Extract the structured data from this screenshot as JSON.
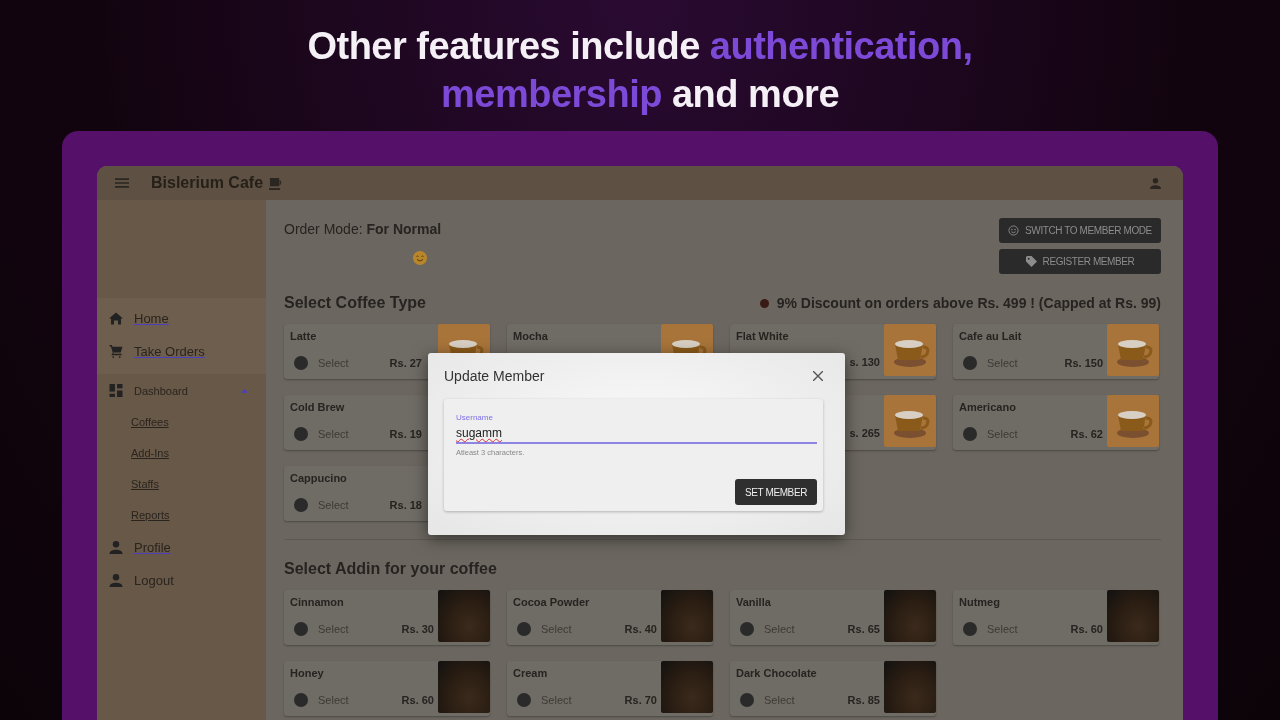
{
  "headline": {
    "lines": [
      [
        {
          "text": "Other features include ",
          "highlight": false
        },
        {
          "text": "authentication,",
          "highlight": true
        }
      ],
      [
        {
          "text": "membership",
          "highlight": true
        },
        {
          "text": " and more",
          "highlight": false
        }
      ]
    ]
  },
  "app": {
    "title": "Bislerium Cafe"
  },
  "sidebar": {
    "items": [
      {
        "label": "Home",
        "kind": "link"
      },
      {
        "label": "Take Orders",
        "kind": "link"
      },
      {
        "label": "Dashboard",
        "kind": "group",
        "expanded": true,
        "children": [
          {
            "label": "Coffees"
          },
          {
            "label": "Add-Ins"
          },
          {
            "label": "Staffs"
          },
          {
            "label": "Reports"
          }
        ]
      },
      {
        "label": "Profile",
        "kind": "link"
      },
      {
        "label": "Logout",
        "kind": "plain"
      }
    ]
  },
  "order_mode": "Order Mode: **For Normal**",
  "buttons": [
    "SWITCH TO MEMBER MODE",
    "REGISTER MEMBER"
  ],
  "coffee_section": {
    "title": "Select Coffee Type",
    "discount": "9% Discount on orders above Rs. 499 ! (Capped at Rs. 99)",
    "rows": [
      [
        {
          "name": "Latte",
          "select": "Select",
          "selected": false,
          "price": "Rs. 27"
        },
        {
          "name": "Mocha"
        },
        {
          "name": "Flat White",
          "price": "s. 130"
        },
        {
          "name": "Cafe au Lait",
          "select": "Select",
          "selected": false,
          "price": "Rs. 150"
        }
      ],
      [
        {
          "name": "Cold Brew",
          "select": "Select",
          "selected": false,
          "price": "Rs. 19"
        },
        null,
        {
          "price": "s. 265"
        },
        {
          "name": "Americano",
          "select": "Select",
          "selected": false,
          "price": "Rs. 62"
        }
      ],
      [
        {
          "name": "Cappucino",
          "select": "Select",
          "selected": false,
          "price": "Rs. 18"
        }
      ]
    ]
  },
  "addin_section": {
    "title": "Select Addin for your coffee",
    "rows": [
      [
        {
          "name": "Cinnamon",
          "select": "Select",
          "selected": false,
          "price": "Rs. 30"
        },
        {
          "name": "Cocoa Powder",
          "select": "Select",
          "selected": false,
          "price": "Rs. 40"
        },
        {
          "name": "Vanilla",
          "select": "Select",
          "selected": false,
          "price": "Rs. 65"
        },
        {
          "name": "Nutmeg",
          "select": "Select",
          "selected": false,
          "price": "Rs. 60"
        }
      ],
      [
        {
          "name": "Honey",
          "select": "Select",
          "selected": false,
          "price": "Rs. 60"
        },
        {
          "name": "Cream",
          "select": "Select",
          "selected": false,
          "price": "Rs. 70"
        },
        {
          "name": "Dark Chocolate",
          "select": "Select",
          "selected": false,
          "price": "Rs. 85"
        }
      ]
    ]
  },
  "dialog": {
    "title": "Update Member",
    "field": {
      "label": "Username",
      "value": "sugamm",
      "hint": "Atleast 3 characters."
    },
    "button": "SET MEMBER"
  }
}
